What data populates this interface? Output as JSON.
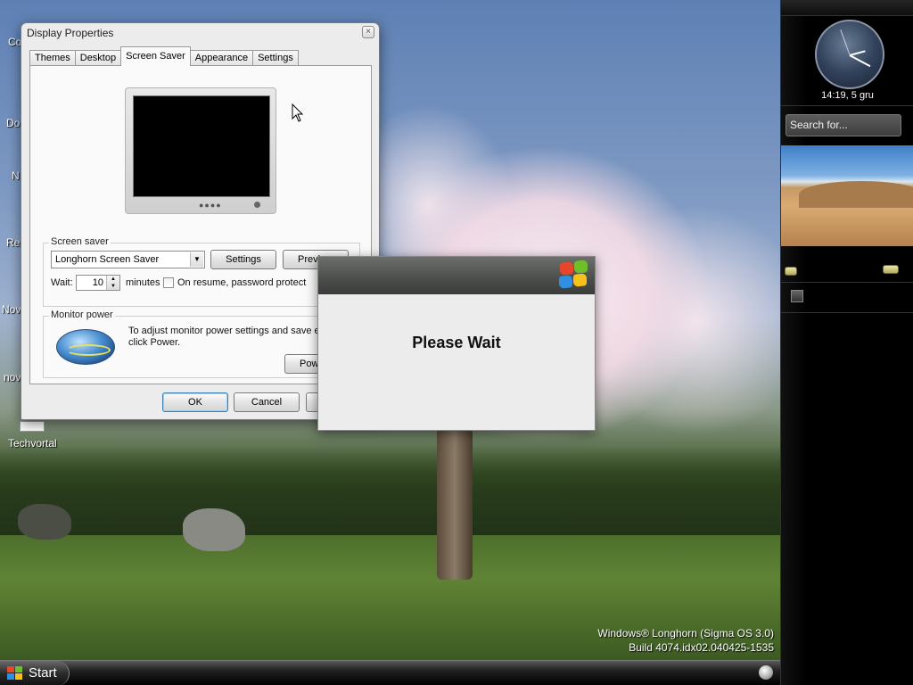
{
  "desktop": {
    "icons": [
      {
        "label": "Co"
      },
      {
        "label": "Do"
      },
      {
        "label": "N"
      },
      {
        "label": "Rec"
      },
      {
        "label": "Nov"
      },
      {
        "label": "nov"
      },
      {
        "label": "Techvortal"
      }
    ],
    "watermark": {
      "line1": "Windows® Longhorn (Sigma OS 3.0)",
      "line2": "Build 4074.idx02.040425-1535"
    }
  },
  "window": {
    "title": "Display Properties",
    "close_label": "×",
    "tabs": [
      {
        "label": "Themes",
        "active": false
      },
      {
        "label": "Desktop",
        "active": false
      },
      {
        "label": "Screen Saver",
        "active": true
      },
      {
        "label": "Appearance",
        "active": false
      },
      {
        "label": "Settings",
        "active": false
      }
    ],
    "screensaver": {
      "group_label": "Screen saver",
      "selected": "Longhorn Screen Saver",
      "settings_label": "Settings",
      "preview_label": "Previ",
      "wait_label": "Wait:",
      "wait_value": "10",
      "minutes_label": "minutes",
      "password_label": "On resume, password protect"
    },
    "monitor_power": {
      "group_label": "Monitor power",
      "text_line1": "To adjust monitor power settings and save en",
      "text_line2": "click Power.",
      "power_label": "Pow"
    },
    "footer": {
      "ok_label": "OK",
      "cancel_label": "Cancel"
    }
  },
  "wait_dialog": {
    "message": "Please Wait"
  },
  "sidebar": {
    "clock_text": "14:19, 5 gru",
    "search_placeholder": "Search for..."
  },
  "taskbar": {
    "start_label": "Start"
  },
  "colors": {
    "accent_blue": "#3c7fb1",
    "flag_red": "#e8452c",
    "flag_green": "#6fbf2a",
    "flag_blue": "#2f8fe0",
    "flag_yellow": "#f7c21a"
  }
}
